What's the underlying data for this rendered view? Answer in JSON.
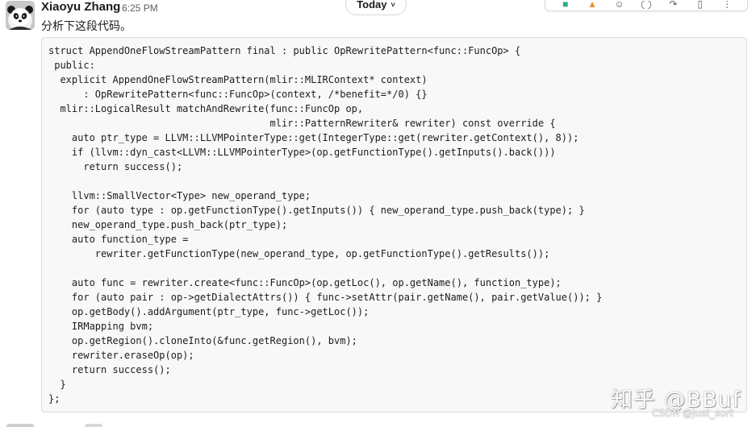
{
  "date_divider": {
    "label": "Today",
    "chevron": "˅"
  },
  "message_actions": {
    "icons": [
      "green-check-icon",
      "orange-reaction-icon",
      "emoji-icon",
      "thread-reply-icon",
      "forward-icon",
      "bookmark-icon",
      "more-icon"
    ]
  },
  "message": {
    "sender": "Xiaoyu Zhang",
    "time": "6:25 PM",
    "text": "分析下这段代码。",
    "code_lines": [
      "struct AppendOneFlowStreamPattern final : public OpRewritePattern<func::FuncOp> {",
      " public:",
      "  explicit AppendOneFlowStreamPattern(mlir::MLIRContext* context)",
      "      : OpRewritePattern<func::FuncOp>(context, /*benefit=*/0) {}",
      "  mlir::LogicalResult matchAndRewrite(func::FuncOp op,",
      "                                      mlir::PatternRewriter& rewriter) const override {",
      "    auto ptr_type = LLVM::LLVMPointerType::get(IntegerType::get(rewriter.getContext(), 8));",
      "    if (llvm::dyn_cast<LLVM::LLVMPointerType>(op.getFunctionType().getInputs().back()))",
      "      return success();",
      "",
      "    llvm::SmallVector<Type> new_operand_type;",
      "    for (auto type : op.getFunctionType().getInputs()) { new_operand_type.push_back(type); }",
      "    new_operand_type.push_back(ptr_type);",
      "    auto function_type =",
      "        rewriter.getFunctionType(new_operand_type, op.getFunctionType().getResults());",
      "",
      "    auto func = rewriter.create<func::FuncOp>(op.getLoc(), op.getName(), function_type);",
      "    for (auto pair : op->getDialectAttrs()) { func->setAttr(pair.getName(), pair.getValue()); }",
      "    op.getBody().addArgument(ptr_type, func->getLoc());",
      "    IRMapping bvm;",
      "    op.getRegion().cloneInto(&func.getRegion(), bvm);",
      "    rewriter.eraseOp(op);",
      "    return success();",
      "  }",
      "};"
    ]
  },
  "watermark": {
    "main": "知乎 @BBuf",
    "source": "CSDN @just_sort"
  },
  "colors": {
    "code_background": "#f8f8f8",
    "code_border": "#dddddd",
    "text": "#1d1c1d",
    "muted": "#616061"
  }
}
